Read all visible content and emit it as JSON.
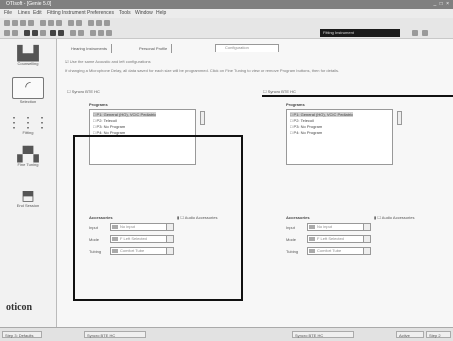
{
  "window": {
    "title": "OTIsoft - [Genie 5.0]",
    "controls": "_ □ ×"
  },
  "menu": [
    "File",
    "Lines",
    "Edit",
    "Fitting Instrument",
    "Preferences",
    "Tools",
    "Window",
    "Help"
  ],
  "toolbar": {
    "device_box": "Fitting Instrument"
  },
  "sidebar": [
    {
      "label": "Counselling"
    },
    {
      "label": "Selection"
    },
    {
      "label": "Fitting"
    },
    {
      "label": "Fine Tuning"
    },
    {
      "label": "End Session"
    }
  ],
  "logo": "oticon",
  "tabs": [
    "Hearing Instruments",
    "Personal Profile",
    "Configuration"
  ],
  "config": {
    "checkbox_label": "Use the same Acoustic and left configurations",
    "description": "If changing a Microphone Delay, all data saved for each size will be programmed. Click on Fine Tuning to view or remove Program buttons, then for details."
  },
  "left": {
    "side_label": "Syncro BTE HC",
    "programs_title": "Programs",
    "programs": [
      "P1: General (HO), VCIC Pediatric",
      "P2: Telecoil",
      "P3: No Program",
      "P4: No Program"
    ],
    "accessories_title": "Accessories",
    "accessories_right": "Audio Accessories",
    "rows": [
      {
        "label": "Input",
        "value": "No input"
      },
      {
        "label": "Mode",
        "value": "F Left Selected"
      },
      {
        "label": "Tubing",
        "value": "Comfort Tube"
      }
    ]
  },
  "right": {
    "side_label": "Syncro BTE HC",
    "programs_title": "Programs",
    "programs": [
      "P1: General (HO), VCIC Pediatric",
      "P2: Telecoil",
      "P3: No Program",
      "P4: No Program"
    ],
    "accessories_title": "Accessories",
    "accessories_right": "Audio Accessories",
    "rows": [
      {
        "label": "Input",
        "value": "No input"
      },
      {
        "label": "Mode",
        "value": "F Left Selected"
      },
      {
        "label": "Tubing",
        "value": "Comfort Tube"
      }
    ]
  },
  "status": [
    "Step 3: Defaults",
    "Syncro BTE HC",
    "Syncro BTE HC",
    "Active",
    "Step 2"
  ]
}
